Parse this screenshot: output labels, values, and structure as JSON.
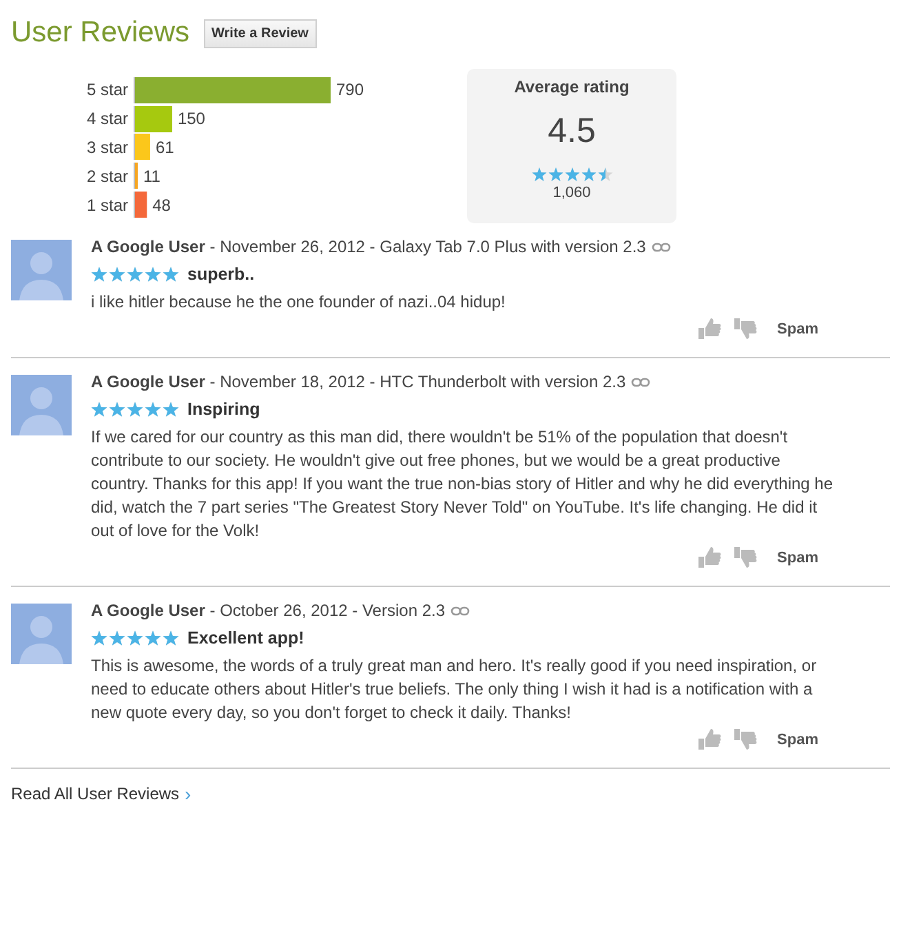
{
  "header": {
    "title": "User Reviews",
    "write_button": "Write a Review"
  },
  "histogram": {
    "chart_data": {
      "type": "bar",
      "orientation": "horizontal",
      "categories": [
        "5 star",
        "4 star",
        "3 star",
        "2 star",
        "1 star"
      ],
      "values": [
        790,
        150,
        61,
        11,
        48
      ],
      "colors": [
        "#8aaf30",
        "#a6c90f",
        "#fbc71b",
        "#f6a623",
        "#f4683a"
      ],
      "data_labels": true
    }
  },
  "average": {
    "label": "Average rating",
    "value": "4.5",
    "stars": 4.5,
    "count": "1,060"
  },
  "reviews": [
    {
      "author": "A Google User",
      "meta": " - November 26, 2012 - Galaxy Tab 7.0 Plus with version 2.3",
      "stars": 5,
      "title": "superb..",
      "body": "i like hitler because he the one founder of nazi..04 hidup!",
      "spam": "Spam"
    },
    {
      "author": "A Google User",
      "meta": " - November 18, 2012 - HTC Thunderbolt with version 2.3",
      "stars": 5,
      "title": "Inspiring",
      "body": "If we cared for our country as this man did, there wouldn't be 51% of the population that doesn't contribute to our society. He wouldn't give out free phones, but we would be a great productive country. Thanks for this app! If you want the true non-bias story of Hitler and why he did everything he did, watch the 7 part series \"The Greatest Story Never Told\" on YouTube. It's life changing. He did it out of love for the Volk!",
      "spam": "Spam"
    },
    {
      "author": "A Google User",
      "meta": " - October 26, 2012 - Version 2.3",
      "stars": 5,
      "title": "Excellent app!",
      "body": "This is awesome, the words of a truly great man and hero. It's really good if you need inspiration, or need to educate others about Hitler's true beliefs. The only thing I wish it had is a notification with a new quote every day, so you don't forget to check it daily. Thanks!",
      "spam": "Spam"
    }
  ],
  "footer": {
    "link": "Read All User Reviews",
    "chevron": "›"
  }
}
